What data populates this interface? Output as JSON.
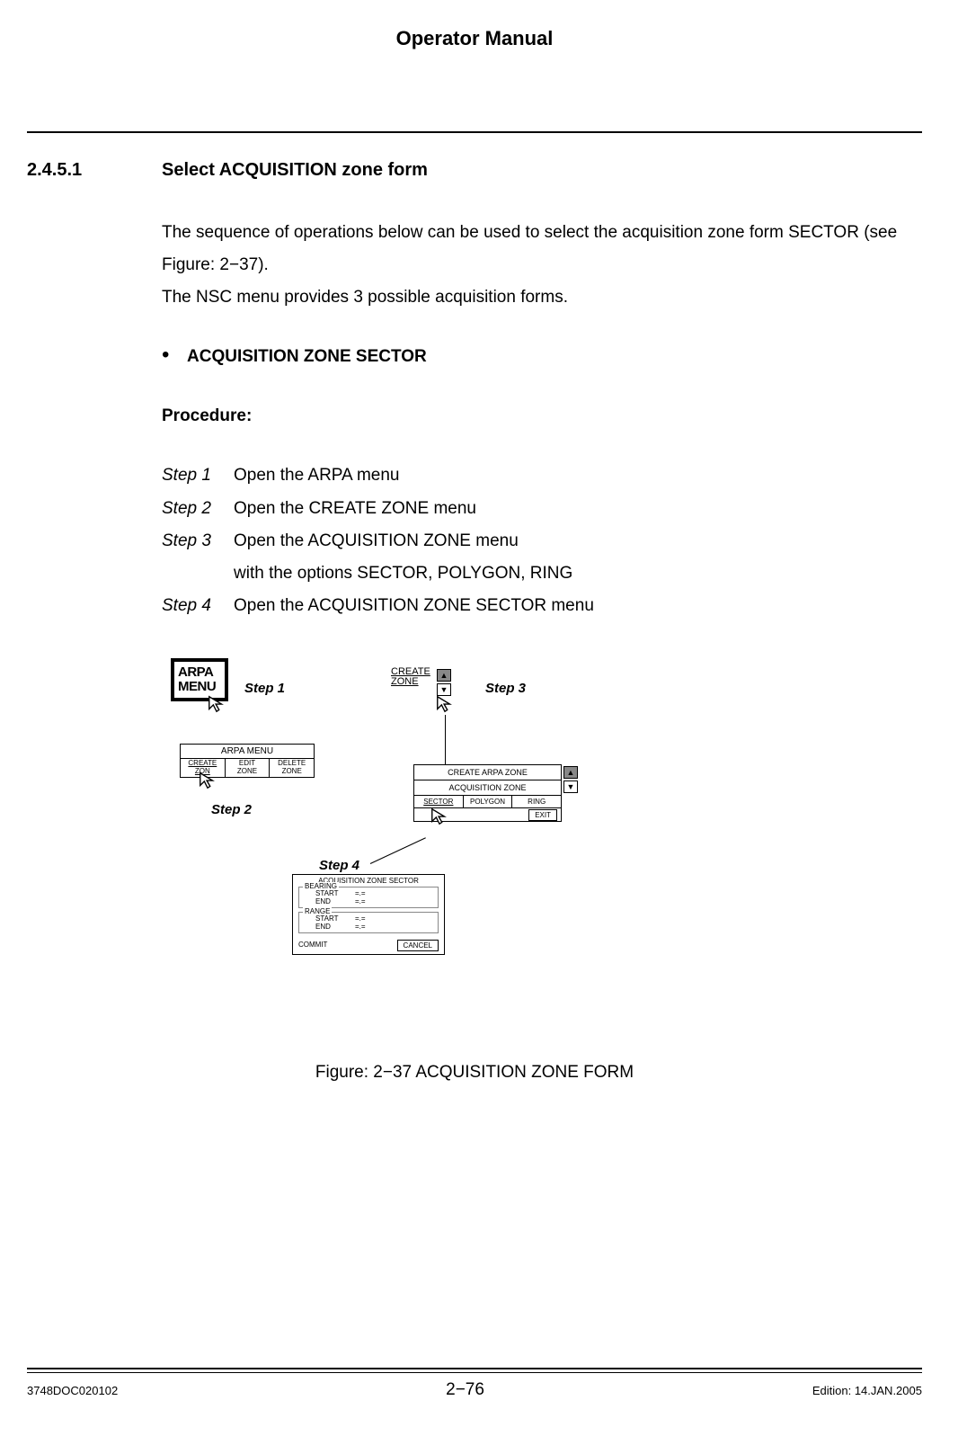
{
  "header": {
    "title": "Operator Manual"
  },
  "section": {
    "number": "2.4.5.1",
    "title": "Select ACQUISITION zone form"
  },
  "intro": {
    "p1": "The sequence of operations below can be used to select the acquisition zone form SECTOR (see Figure: 2−37).",
    "p2": "The NSC menu provides 3 possible acquisition forms."
  },
  "bullet": {
    "text": "ACQUISITION ZONE SECTOR"
  },
  "procedure_label": "Procedure:",
  "steps": [
    {
      "label": "Step 1",
      "text": "Open the ARPA menu"
    },
    {
      "label": "Step 2",
      "text": "Open the CREATE ZONE menu"
    },
    {
      "label": "Step 3",
      "text": "Open the ACQUISITION ZONE menu"
    },
    {
      "label": "",
      "text": "with the options SECTOR, POLYGON, RING"
    },
    {
      "label": "Step 4",
      "text": "Open the ACQUISITION ZONE SECTOR menu"
    }
  ],
  "figure": {
    "arpa_box_l1": "ARPA",
    "arpa_box_l2": "MENU",
    "ann_step1": "Step 1",
    "ann_step2": "Step 2",
    "ann_step3": "Step 3",
    "ann_step4": "Step 4",
    "arpa_menu_title": "ARPA  MENU",
    "arpa_menu_c1a": "CREATE",
    "arpa_menu_c1b": "ZON",
    "arpa_menu_c2a": "EDIT",
    "arpa_menu_c2b": "ZONE",
    "arpa_menu_c3a": "DELETE",
    "arpa_menu_c3b": "ZONE",
    "create_zone_l1": "CREATE",
    "create_zone_l2": "ZONE",
    "caz_title": "CREATE ARPA ZONE",
    "caz_sub": "ACQUISITION  ZONE",
    "caz_c1": "SECTOR",
    "caz_c2": "POLYGON",
    "caz_c3": "RING",
    "caz_exit": "EXIT",
    "sb_title": "ACQUISITION ZONE SECTOR",
    "sb_bearing": "BEARING",
    "sb_range": "RANGE",
    "sb_start": "START",
    "sb_end": "END",
    "sb_val": "=.=",
    "sb_commit": "COMMIT",
    "sb_cancel": "CANCEL",
    "caption": "Figure: 2−37 ACQUISITION ZONE FORM"
  },
  "footer": {
    "left": "3748DOC020102",
    "center": "2−76",
    "right": "Edition: 14.JAN.2005"
  }
}
